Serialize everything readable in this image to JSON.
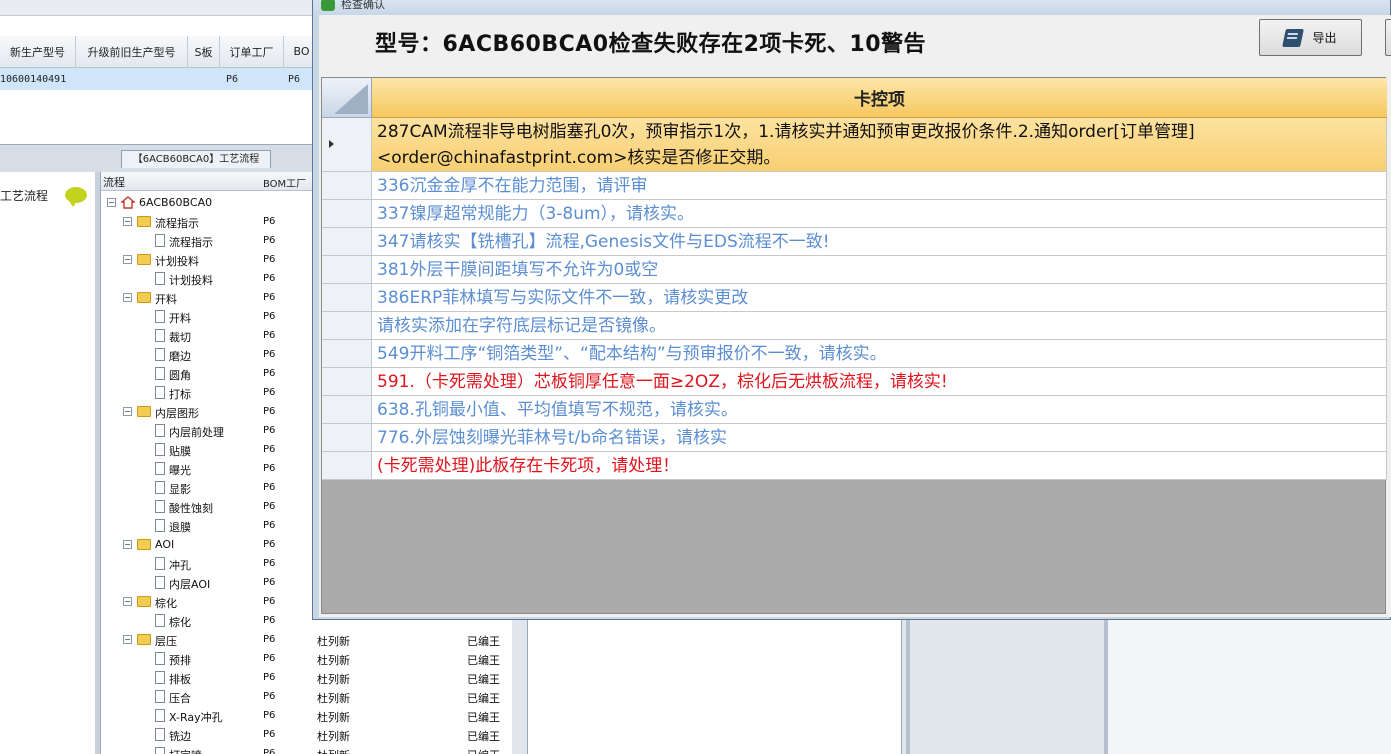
{
  "background": {
    "grid_headers": [
      "新生产型号",
      "升级前旧生产型号",
      "S板",
      "订单工厂",
      "BO"
    ],
    "grid_row": {
      "new_model": "10600140491",
      "old_model": "",
      "s_board": "",
      "factory": "P6",
      "bom": "P6"
    },
    "panel_title": "【6ACB60BCA0】工艺流程",
    "left_panel_label": "工艺流程",
    "tree_headers": {
      "flow": "流程",
      "bom_factory": "BOM工厂"
    },
    "tree": [
      {
        "level": 0,
        "type": "root",
        "label": "6ACB60BCA0",
        "bom": "",
        "c3": "",
        "c4": ""
      },
      {
        "level": 1,
        "type": "folder",
        "label": "流程指示",
        "bom": "P6",
        "c3": "",
        "c4": ""
      },
      {
        "level": 2,
        "type": "doc",
        "label": "流程指示",
        "bom": "P6",
        "c3": "",
        "c4": ""
      },
      {
        "level": 1,
        "type": "folder",
        "label": "计划投料",
        "bom": "P6",
        "c3": "",
        "c4": ""
      },
      {
        "level": 2,
        "type": "doc",
        "label": "计划投料",
        "bom": "P6",
        "c3": "",
        "c4": ""
      },
      {
        "level": 1,
        "type": "folder",
        "label": "开料",
        "bom": "P6",
        "c3": "",
        "c4": ""
      },
      {
        "level": 2,
        "type": "doc",
        "label": "开料",
        "bom": "P6",
        "c3": "",
        "c4": ""
      },
      {
        "level": 2,
        "type": "doc",
        "label": "裁切",
        "bom": "P6",
        "c3": "",
        "c4": ""
      },
      {
        "level": 2,
        "type": "doc",
        "label": "磨边",
        "bom": "P6",
        "c3": "",
        "c4": ""
      },
      {
        "level": 2,
        "type": "doc",
        "label": "圆角",
        "bom": "P6",
        "c3": "",
        "c4": ""
      },
      {
        "level": 2,
        "type": "doc",
        "label": "打标",
        "bom": "P6",
        "c3": "",
        "c4": ""
      },
      {
        "level": 1,
        "type": "folder",
        "label": "内层图形",
        "bom": "P6",
        "c3": "",
        "c4": ""
      },
      {
        "level": 2,
        "type": "doc",
        "label": "内层前处理",
        "bom": "P6",
        "c3": "",
        "c4": ""
      },
      {
        "level": 2,
        "type": "doc",
        "label": "贴膜",
        "bom": "P6",
        "c3": "",
        "c4": ""
      },
      {
        "level": 2,
        "type": "doc",
        "label": "曝光",
        "bom": "P6",
        "c3": "",
        "c4": ""
      },
      {
        "level": 2,
        "type": "doc",
        "label": "显影",
        "bom": "P6",
        "c3": "",
        "c4": ""
      },
      {
        "level": 2,
        "type": "doc",
        "label": "酸性蚀刻",
        "bom": "P6",
        "c3": "",
        "c4": ""
      },
      {
        "level": 2,
        "type": "doc",
        "label": "退膜",
        "bom": "P6",
        "c3": "",
        "c4": ""
      },
      {
        "level": 1,
        "type": "folder",
        "label": "AOI",
        "bom": "P6",
        "c3": "",
        "c4": ""
      },
      {
        "level": 2,
        "type": "doc",
        "label": "冲孔",
        "bom": "P6",
        "c3": "",
        "c4": ""
      },
      {
        "level": 2,
        "type": "doc",
        "label": "内层AOI",
        "bom": "P6",
        "c3": "",
        "c4": ""
      },
      {
        "level": 1,
        "type": "folder",
        "label": "棕化",
        "bom": "P6",
        "c3": "",
        "c4": ""
      },
      {
        "level": 2,
        "type": "doc",
        "label": "棕化",
        "bom": "P6",
        "c3": "",
        "c4": ""
      },
      {
        "level": 1,
        "type": "folder",
        "label": "层压",
        "bom": "P6",
        "c3": "杜列新",
        "c4": "已编王"
      },
      {
        "level": 2,
        "type": "doc",
        "label": "预排",
        "bom": "P6",
        "c3": "杜列新",
        "c4": "已编王"
      },
      {
        "level": 2,
        "type": "doc",
        "label": "排板",
        "bom": "P6",
        "c3": "杜列新",
        "c4": "已编王"
      },
      {
        "level": 2,
        "type": "doc",
        "label": "压合",
        "bom": "P6",
        "c3": "杜列新",
        "c4": "已编王"
      },
      {
        "level": 2,
        "type": "doc",
        "label": "X-Ray冲孔",
        "bom": "P6",
        "c3": "杜列新",
        "c4": "已编王"
      },
      {
        "level": 2,
        "type": "doc",
        "label": "铣边",
        "bom": "P6",
        "c3": "杜列新",
        "c4": "已编王"
      },
      {
        "level": 2,
        "type": "doc",
        "label": "打定喷",
        "bom": "P6",
        "c3": "杜列新",
        "c4": "已编王"
      }
    ]
  },
  "dialog": {
    "title": "检查确认",
    "heading": "型号：6ACB60BCA0检查失败存在2项卡死、10警告",
    "export_label": "导出",
    "column_header": "卡控项",
    "colors": {
      "blue": "#5b8ed2",
      "red": "#e0141c",
      "dark": "#111111",
      "selected_bg": "#f8cf72"
    },
    "rows": [
      {
        "text": "287CAM流程非导电树脂塞孔0次，预审指示1次，1.请核实并通知预审更改报价条件.2.通知order[订单管理] <order@chinafastprint.com>核实是否修正交期。",
        "color": "dark",
        "selected": true
      },
      {
        "text": "336沉金金厚不在能力范围，请评审",
        "color": "blue",
        "selected": false
      },
      {
        "text": "337镍厚超常规能力（3-8um），请核实。",
        "color": "blue",
        "selected": false
      },
      {
        "text": "347请核实【铣槽孔】流程,Genesis文件与EDS流程不一致!",
        "color": "blue",
        "selected": false
      },
      {
        "text": "381外层干膜间距填写不允许为0或空",
        "color": "blue",
        "selected": false
      },
      {
        "text": "386ERP菲林填写与实际文件不一致，请核实更改",
        "color": "blue",
        "selected": false
      },
      {
        "text": "请核实添加在字符底层标记是否镜像。",
        "color": "blue",
        "selected": false
      },
      {
        "text": "549开料工序“铜箔类型”、“配本结构”与预审报价不一致，请核实。",
        "color": "blue",
        "selected": false
      },
      {
        "text": "591.（卡死需处理）芯板铜厚任意一面≥2OZ，棕化后无烘板流程，请核实!",
        "color": "red",
        "selected": false
      },
      {
        "text": "638.孔铜最小值、平均值填写不规范，请核实。",
        "color": "blue",
        "selected": false
      },
      {
        "text": "776.外层蚀刻曝光菲林号t/b命名错误，请核实",
        "color": "blue",
        "selected": false
      },
      {
        "text": "(卡死需处理)此板存在卡死项，请处理！",
        "color": "red",
        "selected": false
      }
    ]
  }
}
